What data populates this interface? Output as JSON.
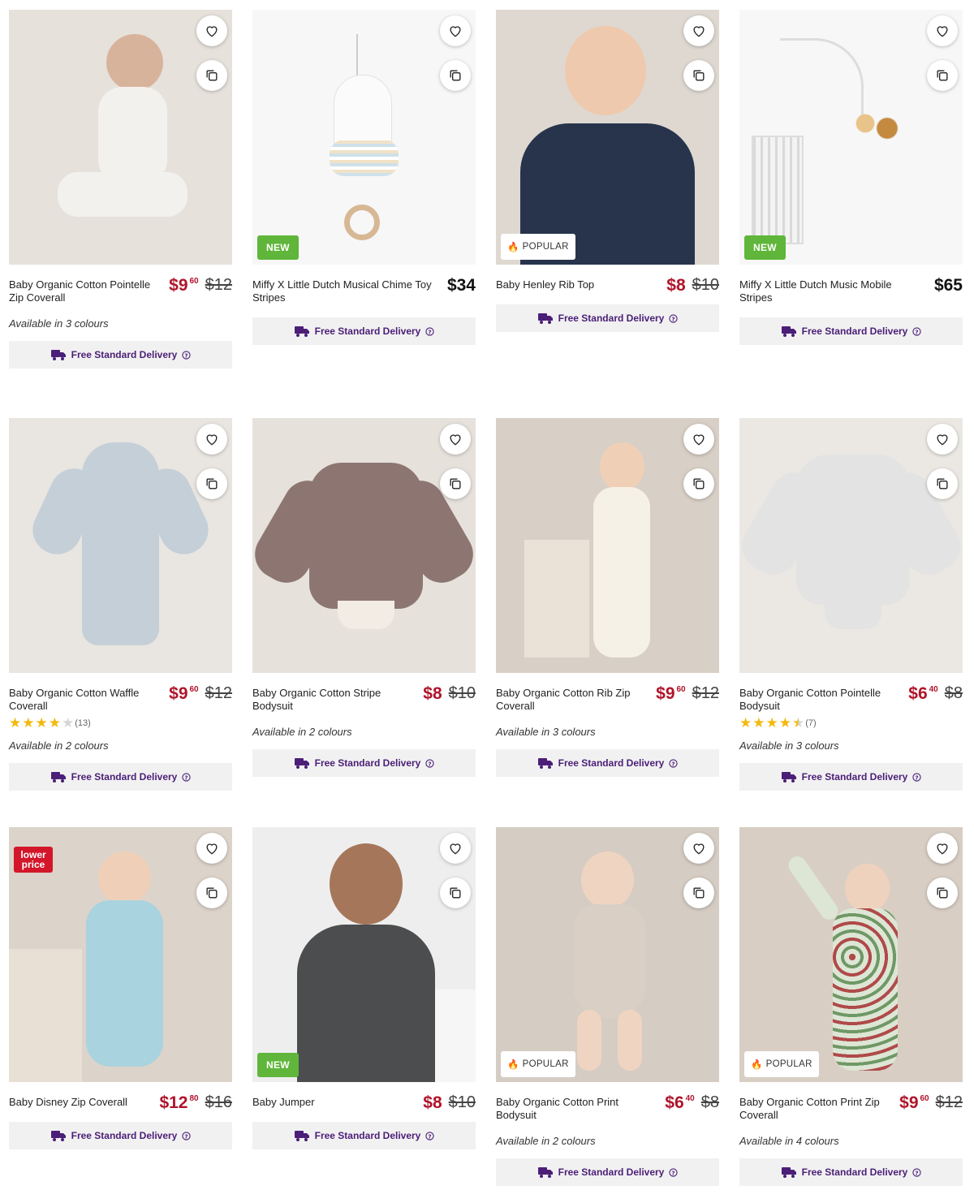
{
  "delivery_label": "Free Standard Delivery",
  "accent": "#4b1e77",
  "sale_color": "#b0142a",
  "products": [
    {
      "name": "Baby Organic Cotton Pointelle Zip Coverall",
      "price_dollars": "$9",
      "price_cents": "60",
      "was": "$12",
      "colours": "Available in 3 colours"
    },
    {
      "name": "Miffy X Little Dutch Musical Chime Toy Stripes",
      "price_dollars": "$34",
      "price_cents": "",
      "was": "",
      "badge": "NEW"
    },
    {
      "name": "Baby Henley Rib Top",
      "price_dollars": "$8",
      "price_cents": "",
      "was": "$10",
      "badge": "POPULAR"
    },
    {
      "name": "Miffy X Little Dutch Music Mobile Stripes",
      "price_dollars": "$65",
      "price_cents": "",
      "was": "",
      "badge": "NEW"
    },
    {
      "name": "Baby Organic Cotton Waffle Coverall",
      "price_dollars": "$9",
      "price_cents": "60",
      "was": "$12",
      "rating": 4,
      "reviews": "(13)",
      "colours": "Available in 2 colours"
    },
    {
      "name": "Baby Organic Cotton Stripe Bodysuit",
      "price_dollars": "$8",
      "price_cents": "",
      "was": "$10",
      "colours": "Available in 2 colours"
    },
    {
      "name": "Baby Organic Cotton Rib Zip Coverall",
      "price_dollars": "$9",
      "price_cents": "60",
      "was": "$12",
      "colours": "Available in 3 colours"
    },
    {
      "name": "Baby Organic Cotton Pointelle Bodysuit",
      "price_dollars": "$6",
      "price_cents": "40",
      "was": "$8",
      "rating": 4.5,
      "reviews": "(7)",
      "colours": "Available in 3 colours"
    },
    {
      "name": "Baby Disney Zip Coverall",
      "price_dollars": "$12",
      "price_cents": "80",
      "was": "$16",
      "badge_top_line1": "lower",
      "badge_top_line2": "price"
    },
    {
      "name": "Baby Jumper",
      "price_dollars": "$8",
      "price_cents": "",
      "was": "$10",
      "badge": "NEW"
    },
    {
      "name": "Baby Organic Cotton Print Bodysuit",
      "price_dollars": "$6",
      "price_cents": "40",
      "was": "$8",
      "badge": "POPULAR",
      "colours": "Available in 2 colours"
    },
    {
      "name": "Baby Organic Cotton Print Zip Coverall",
      "price_dollars": "$9",
      "price_cents": "60",
      "was": "$12",
      "badge": "POPULAR",
      "colours": "Available in 4 colours"
    }
  ]
}
